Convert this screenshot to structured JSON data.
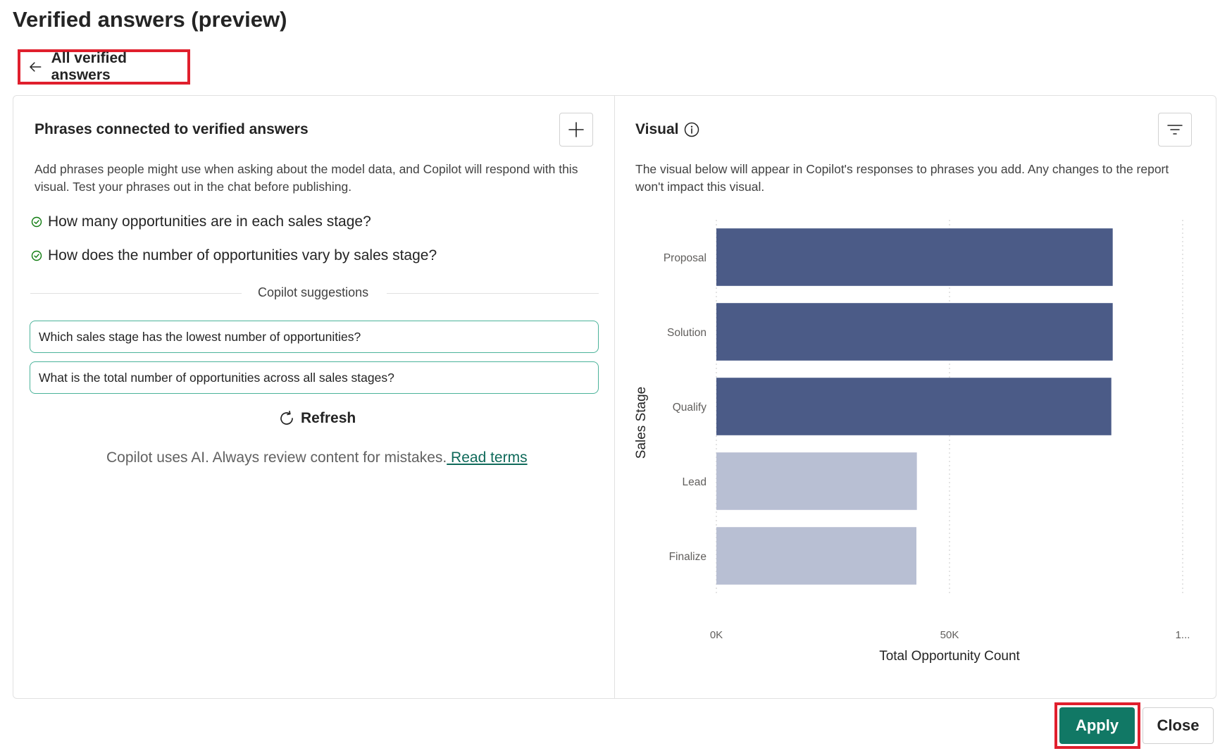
{
  "header": {
    "title": "Verified answers (preview)",
    "back_label": "All verified answers"
  },
  "left_panel": {
    "title": "Phrases connected to verified answers",
    "description": "Add phrases people might use when asking about the model data, and Copilot will respond with this visual. Test your phrases out in the chat before publishing.",
    "phrases": [
      "How many opportunities are in each sales stage?",
      "How does the number of opportunities vary by sales stage?"
    ],
    "suggestions_label": "Copilot suggestions",
    "suggestions": [
      "Which sales stage has the lowest number of opportunities?",
      "What is the total number of opportunities across all sales stages?"
    ],
    "refresh_label": "Refresh",
    "disclaimer": "Copilot uses AI. Always review content for mistakes.",
    "terms_link": " Read terms"
  },
  "right_panel": {
    "title": "Visual",
    "description": "The visual below will appear in Copilot's responses to phrases you add. Any changes to the report won't impact this visual."
  },
  "chart_data": {
    "type": "bar",
    "orientation": "horizontal",
    "title": "",
    "xlabel": "Total Opportunity Count",
    "ylabel": "Sales Stage",
    "categories": [
      "Proposal",
      "Solution",
      "Qualify",
      "Lead",
      "Finalize"
    ],
    "values": [
      85000,
      85000,
      84700,
      43000,
      42900
    ],
    "colors": [
      "#4b5b87",
      "#4b5b87",
      "#4b5b87",
      "#b8bfd3",
      "#b8bfd3"
    ],
    "x_ticks": [
      "0K",
      "50K",
      "1..."
    ],
    "xlim": [
      0,
      100000
    ],
    "grid": "vertical dotted"
  },
  "footer": {
    "apply_label": "Apply",
    "close_label": "Close"
  },
  "colors": {
    "accent": "#117865",
    "highlight_border": "#e01f2d",
    "chip_border": "#4bb39a"
  }
}
